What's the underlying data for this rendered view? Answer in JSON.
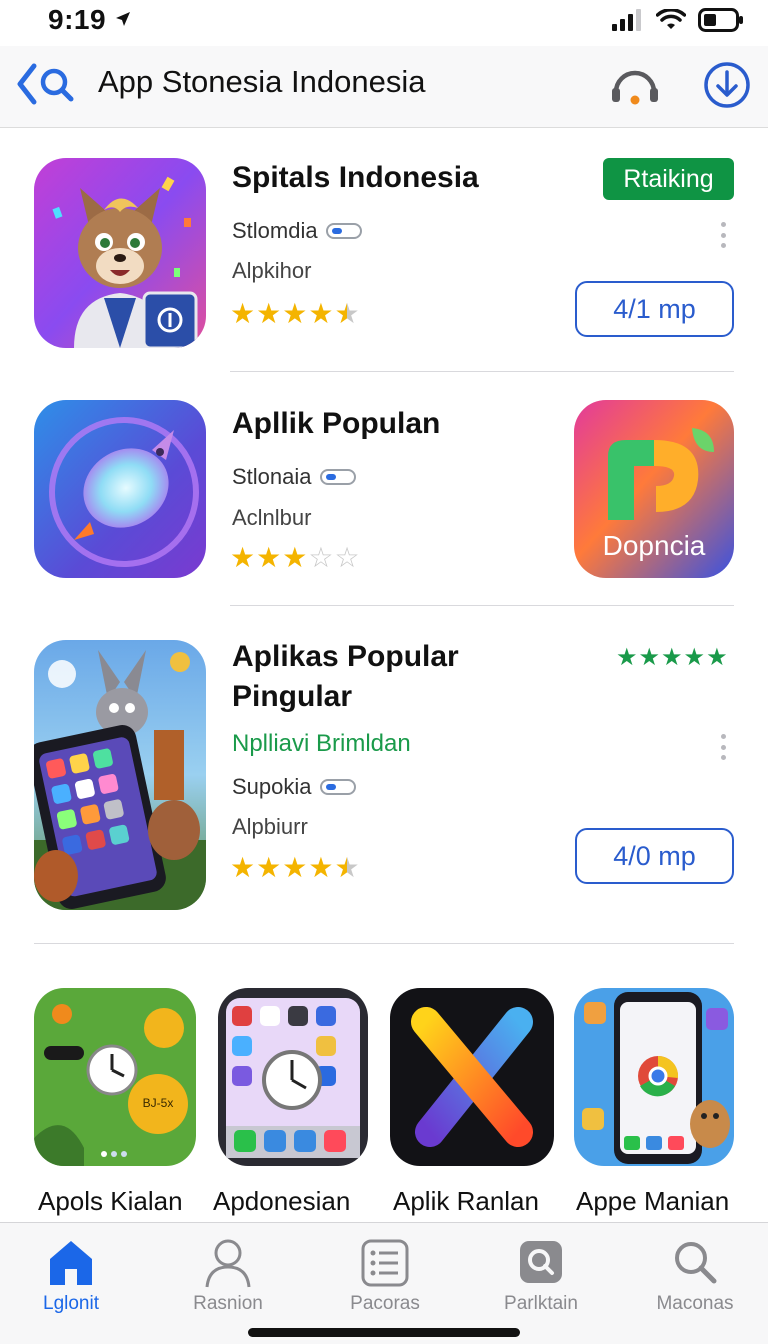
{
  "status_bar": {
    "time": "9:19"
  },
  "header": {
    "title": "App Stonesia Indonesia"
  },
  "apps": [
    {
      "name": "Spitals Indonesia",
      "badge": "Rtaiking",
      "developer": "Stlomdia",
      "category": "Alpkihor",
      "rating": 4.5,
      "button": "4/1 mp",
      "icon": "fox-character-icon"
    },
    {
      "name": "Apllik Populan",
      "developer": "Stlonaia",
      "category": "Aclnlbur",
      "rating": 3,
      "promo_label": "Dopncia",
      "icon": "rocket-bulb-icon",
      "promo_icon": "colorful-logo-icon"
    },
    {
      "name_line1": "Aplikas Popular",
      "name_line2": "Pingular",
      "subtitle": "Nplliavi Brimldan",
      "developer": "Supokia",
      "category": "Alpbiurr",
      "rating": 4.5,
      "top_rating": 5,
      "button": "4/0 mp",
      "icon": "phone-characters-icon"
    }
  ],
  "grid": [
    {
      "label": "Apols Kialan",
      "icon": "green-clock-app-icon",
      "pill": "BJ-5x"
    },
    {
      "label": "Apdonesian",
      "icon": "phone-clock-app-icon"
    },
    {
      "label": "Aplik Ranlan",
      "icon": "x-logo-app-icon"
    },
    {
      "label": "Appe Manian",
      "icon": "chrome-phone-app-icon"
    }
  ],
  "tabs": [
    {
      "label": "Lglonit",
      "icon": "home-icon",
      "active": true
    },
    {
      "label": "Rasnion",
      "icon": "person-icon",
      "active": false
    },
    {
      "label": "Pacoras",
      "icon": "list-icon",
      "active": false
    },
    {
      "label": "Parlktain",
      "icon": "search-app-icon",
      "active": false
    },
    {
      "label": "Maconas",
      "icon": "search-icon",
      "active": false
    }
  ],
  "colors": {
    "accent": "#1b67e8",
    "badge_green": "#0f9444",
    "button_blue": "#2a5ccd",
    "star": "#f4b400"
  }
}
